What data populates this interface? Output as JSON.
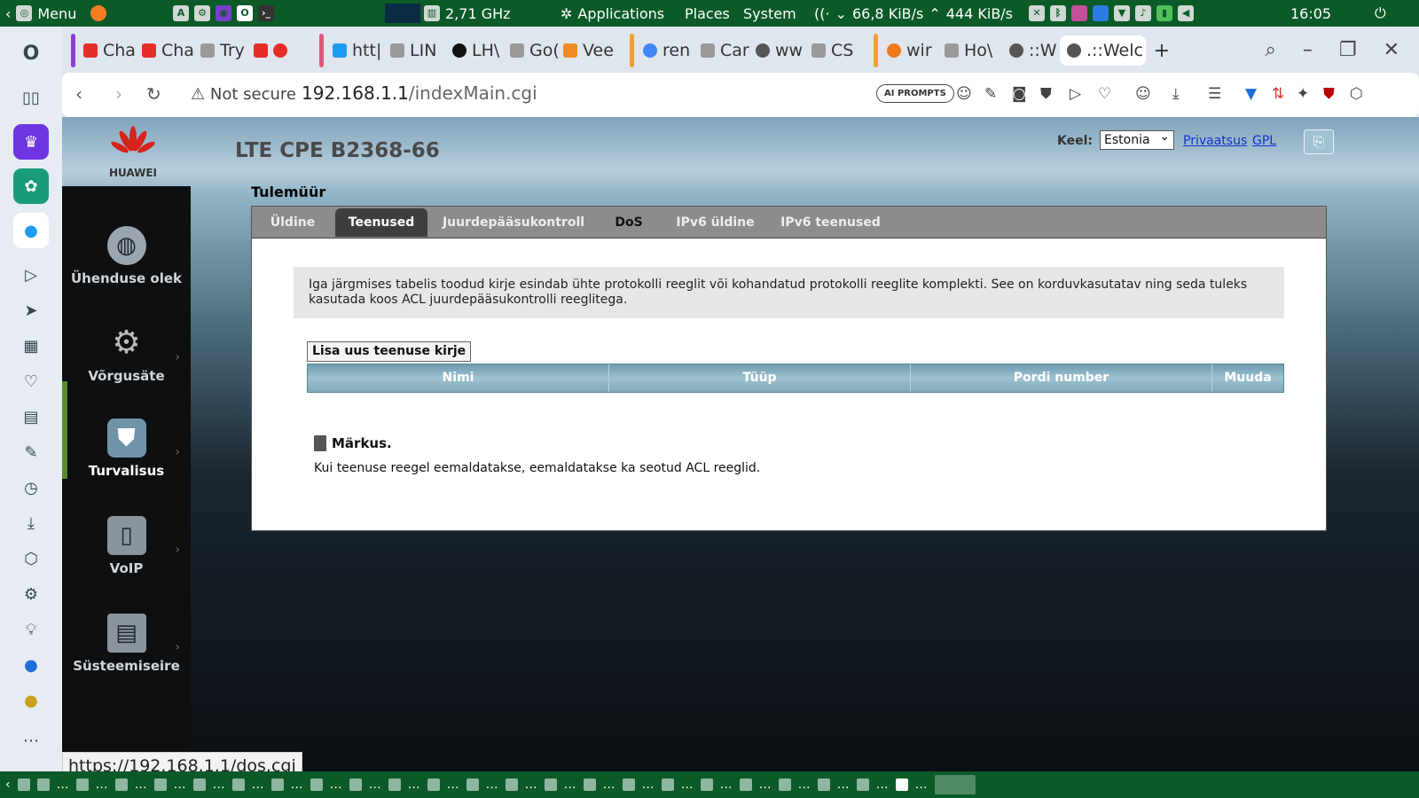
{
  "top_panel": {
    "menu_label": "Menu",
    "cpu_freq": "2,71 GHz",
    "applications": "Applications",
    "places": "Places",
    "system": "System",
    "net_down": "66,8 KiB/s",
    "net_up": "444 KiB/s",
    "clock": "16:05"
  },
  "browser": {
    "tabs": [
      "Cha",
      "Cha",
      "Try",
      "",
      "htt|",
      "LIN",
      "LH\\",
      "Go(",
      "Vee",
      "ren",
      "Car",
      "ww",
      "CS",
      "wir",
      "Ho\\",
      "::W",
      ".::Welc"
    ],
    "url_secure_label": "Not secure",
    "url_host": "192.168.1.1",
    "url_path": "/indexMain.cgi",
    "ai_prompts": "AI PROMPTS",
    "status_url": "https://192.168.1.1/dos.cgi"
  },
  "router": {
    "brand": "HUAWEI",
    "product": "LTE CPE B2368-66",
    "lang_label": "Keel:",
    "lang_value": "Estonia",
    "privacy_link": "Privaatsus",
    "gpl_link": "GPL",
    "nav": [
      "Ühenduse olek",
      "Võrgusäte",
      "Turvalisus",
      "VoIP",
      "Süsteemiseire"
    ],
    "section_title": "Tulemüür",
    "tabs": [
      "Üldine",
      "Teenused",
      "Juurdepääsukontroll",
      "DoS",
      "IPv6 üldine",
      "IPv6 teenused"
    ],
    "info": "Iga järgmises tabelis toodud kirje esindab ühte protokolli reeglit või kohandatud protokolli reeglite komplekti. See on korduvkasutatav ning seda tuleks kasutada koos ACL juurdepääsukontrolli reeglitega.",
    "add_button": "Lisa uus teenuse kirje",
    "table_headers": [
      "Nimi",
      "Tüüp",
      "Pordi number",
      "Muuda"
    ],
    "note_title": "Märkus.",
    "note_text": "Kui teenuse reegel eemaldatakse, eemaldatakse ka seotud ACL reeglid."
  }
}
